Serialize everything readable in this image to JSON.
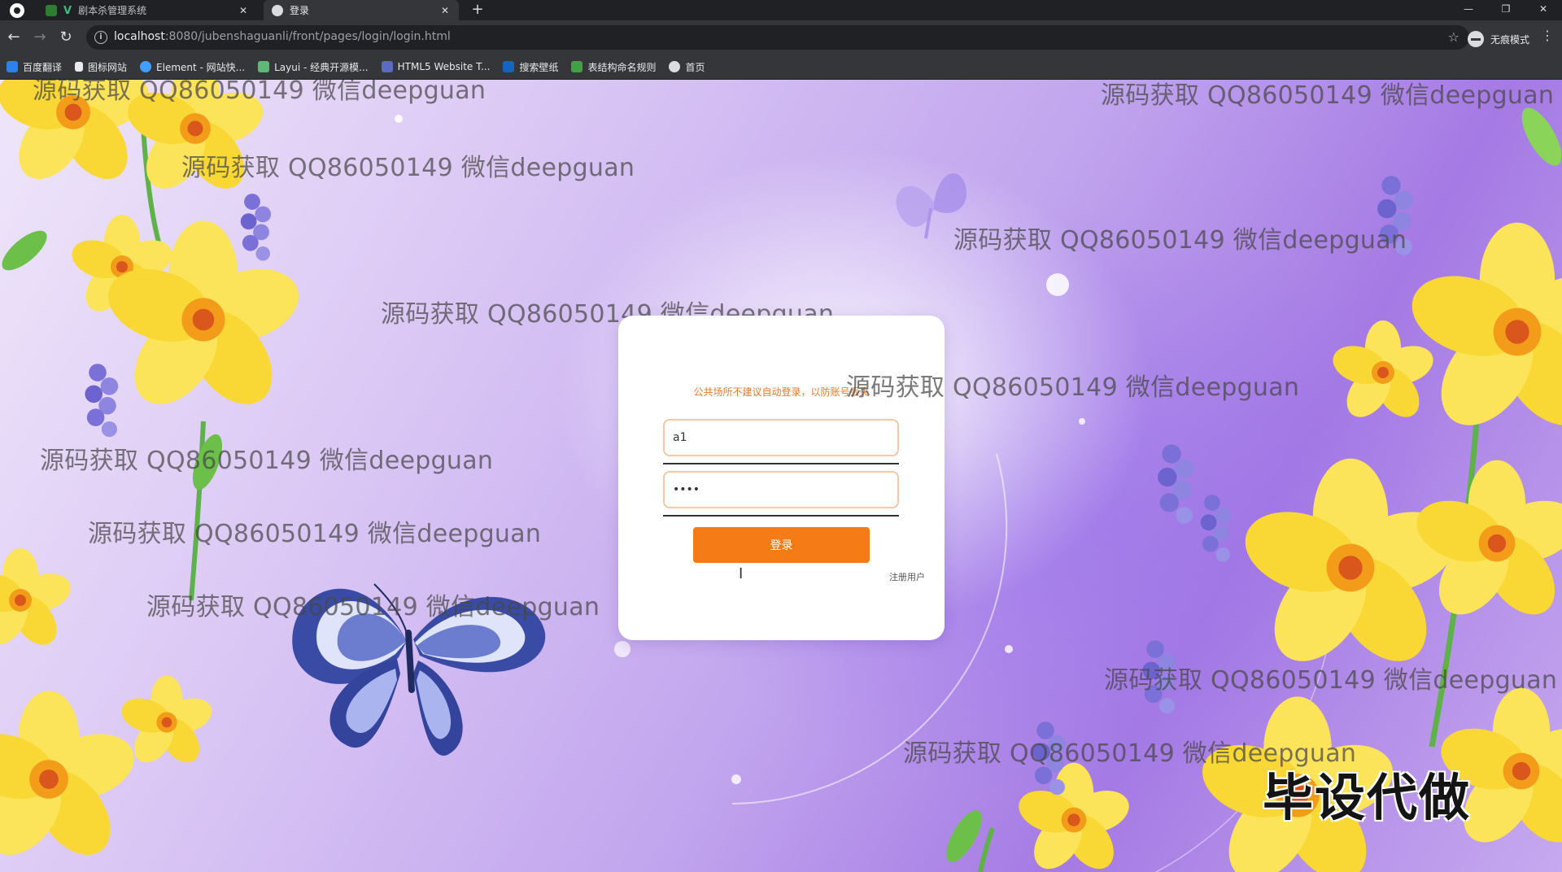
{
  "browser": {
    "tabs": [
      {
        "label": "剧本杀管理系统",
        "active": false
      },
      {
        "label": "登录",
        "active": true
      }
    ],
    "url_host": "localhost",
    "url_path": ":8080/jubenshaguanli/front/pages/login/login.html",
    "incognito_label": "无痕模式",
    "bookmarks": [
      "百度翻译",
      "图标网站",
      "Element - 网站快...",
      "Layui - 经典开源模...",
      "HTML5 Website T...",
      "搜索壁纸",
      "表结构命名规则",
      "首页"
    ]
  },
  "login": {
    "notice": "公共场所不建议自动登录，以防账号丢失",
    "username": "a1",
    "password": "1234",
    "login_button": "登录",
    "register_link": "注册用户"
  },
  "watermark": "源码获取 QQ86050149 微信deepguan",
  "promo": "毕设代做",
  "colors": {
    "accent": "#f47b16",
    "input_border": "#f7c8a6",
    "notice": "#e8792a"
  }
}
